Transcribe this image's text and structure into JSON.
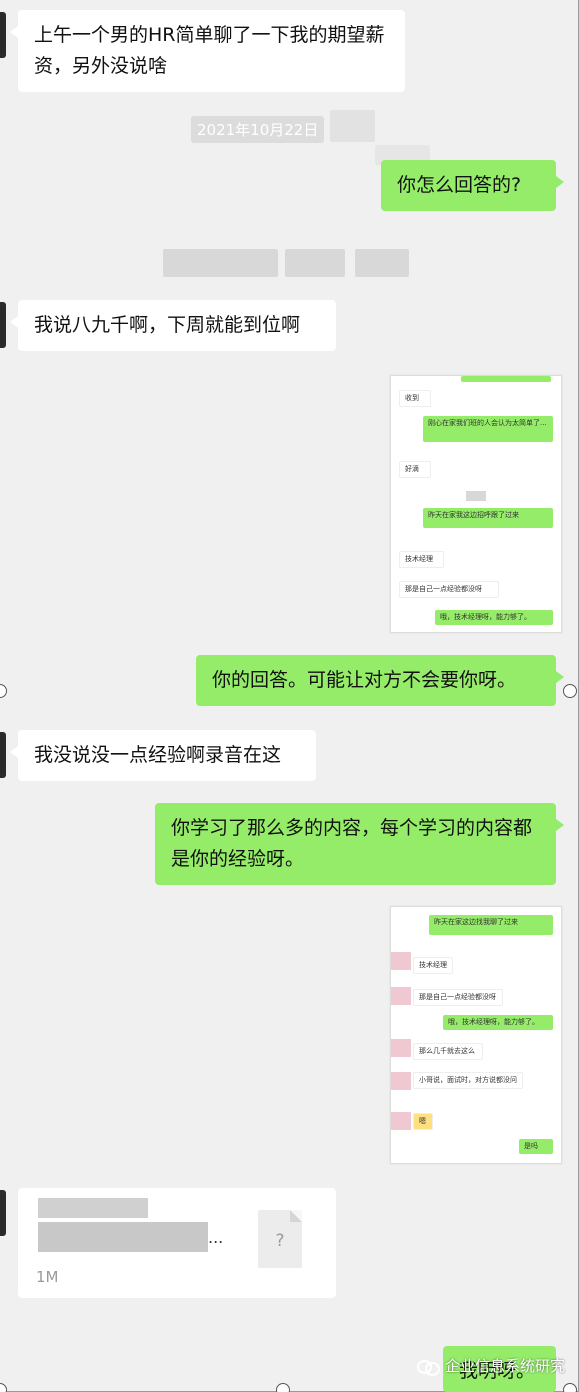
{
  "messages": {
    "m1": "上午一个男的HR简单聊了一下我的期望薪资，另外没说啥",
    "timestamp": "2021年10月22日",
    "m2": "你怎么回答的?",
    "m3": "我说八九千啊，下周就能到位啊",
    "m4": "你的回答。可能让对方不会要你呀。",
    "m5": "我没说没一点经验啊录音在这",
    "m6": "你学习了那么多的内容，每个学习的内容都是你的经验呀。",
    "m7": "我明呀。"
  },
  "shot1": {
    "rows": [
      "收到",
      "刚心在家我们班的人会认为太简单了...",
      "好滴",
      "昨天在家我这边招呼跟了过来",
      "技术经理",
      "那是自己一点经验都没呀",
      "哦，技术经理呀，能力够了。"
    ]
  },
  "shot2": {
    "rows": [
      "昨天在家这边找我聊了过来",
      "技术经理",
      "那是自己一点经验都没呀",
      "哦，技术经理呀，能力够了。",
      "那么几千就去这么",
      "小哥说，面试时，对方说都没问",
      "嗯",
      "是吗"
    ]
  },
  "file": {
    "ellipsis": "...",
    "icon_glyph": "?",
    "size": "1M"
  },
  "watermark": {
    "label": "企业信息系统研究"
  },
  "colors": {
    "self_bubble": "#95ec69",
    "other_bubble": "#ffffff",
    "background": "#f0f0f0"
  }
}
